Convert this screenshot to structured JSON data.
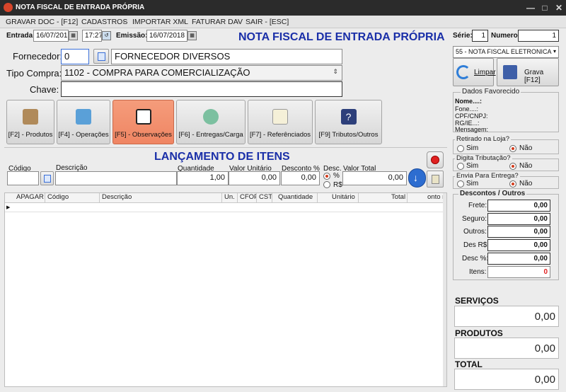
{
  "window": {
    "title": "NOTA FISCAL DE ENTRADA PRÓPRIA"
  },
  "menu": {
    "items": [
      "GRAVAR DOC - [F12]",
      "CADASTROS",
      "IMPORTAR XML",
      "FATURAR DAV",
      "SAIR - [ESC]"
    ],
    "separator": "-"
  },
  "header": {
    "entrada_label": "Entrada:",
    "entrada_date": "16/07/2018",
    "entrada_time": "17:27",
    "emissao_label": "Emissão:",
    "emissao_date": "16/07/2018",
    "page_title": "NOTA FISCAL DE ENTRADA PRÓPRIA",
    "serie_label": "Série:",
    "serie_value": "1",
    "numero_label": "Numero:",
    "numero_value": "1",
    "modelo_value": "55  - NOTA FISCAL ELETRONICA"
  },
  "form": {
    "fornecedor_label": "Fornecedor:",
    "fornecedor_code": "0",
    "fornecedor_name": "FORNECEDOR DIVERSOS",
    "tipo_label": "Tipo Compra:",
    "tipo_value": "1102 - COMPRA PARA COMERCIALIZAÇÃO",
    "chave_label": "Chave:",
    "chave_value": ""
  },
  "actions": {
    "limpar": "Limpar",
    "grava": "Grava [F12]"
  },
  "tabs": [
    "[F2] - Produtos",
    "[F4] - Operações",
    "[F5] - Observações",
    "[F6] - Entregas/Carga",
    "[F7] - Referênciados",
    "[F9] Tributos/Outros"
  ],
  "lancamento": {
    "title": "LANÇAMENTO DE ITENS",
    "codigo_label": "Código",
    "descricao_label": "Descrição",
    "quantidade_label": "Quantidade",
    "valor_unit_label": "Valor Unitário",
    "desconto_label": "Desconto %",
    "desc_label": "Desc.",
    "pct_label": "%",
    "rs_label": "R$",
    "valor_total_label": "Valor Total",
    "quantidade_value": "1,00",
    "valor_unit_value": "0,00",
    "desconto_value": "0,00",
    "valor_total_value": "0,00"
  },
  "table": {
    "columns": [
      "APAGAR",
      "Código",
      "Descrição",
      "Un.",
      "CFOP",
      "CST",
      "Quantidade",
      "Unitário",
      "Total",
      "onto no"
    ]
  },
  "favorecido": {
    "title": "Dados Favorecido",
    "nome": "Nome....:",
    "fone": "Fone....:",
    "cpf": "CPF/CNPJ:",
    "rg": "RG/IE...:",
    "mensagem": "Mensagem:"
  },
  "options": {
    "retirado": "Retirado na Loja?",
    "digita": "Digita Tributação?",
    "envia": "Envia Para Entrega?",
    "sim": "Sim",
    "nao": "Não"
  },
  "descontos": {
    "title": "Descontos / Outros",
    "frete_label": "Frete:",
    "frete": "0,00",
    "seguro_label": "Seguro:",
    "seguro": "0,00",
    "outros_label": "Outros:",
    "outros": "0,00",
    "desrs_label": "Des R$:",
    "desrs": "0,00",
    "descpct_label": "Desc %:",
    "descpct": "0,00",
    "itens_label": "Itens:",
    "itens": "0"
  },
  "totals": {
    "servicos_label": "SERVIÇOS",
    "servicos": "0,00",
    "produtos_label": "PRODUTOS",
    "produtos": "0,00",
    "total_label": "TOTAL",
    "total": "0,00"
  },
  "colors": {
    "accent": "#1a2fa8",
    "active_tab": "#f08a66",
    "title_bar": "#2b2b2b",
    "radio_on": "#d23b1b"
  }
}
